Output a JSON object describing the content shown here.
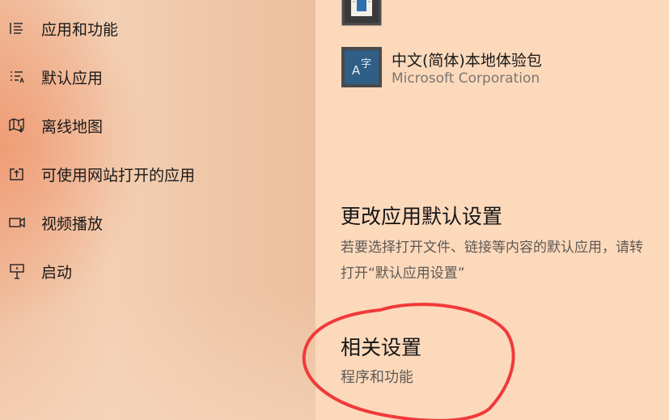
{
  "sidebar": {
    "items": [
      {
        "label": "应用和功能",
        "icon": "apps-features-icon"
      },
      {
        "label": "默认应用",
        "icon": "default-apps-icon"
      },
      {
        "label": "离线地图",
        "icon": "offline-maps-icon"
      },
      {
        "label": "可使用网站打开的应用",
        "icon": "apps-for-websites-icon"
      },
      {
        "label": "视频播放",
        "icon": "video-playback-icon"
      },
      {
        "label": "启动",
        "icon": "startup-icon"
      }
    ]
  },
  "main": {
    "apps": [
      {
        "name": "",
        "publisher": "",
        "icon": "app-icon",
        "partially_visible": true
      },
      {
        "name": "中文(简体)本地体验包",
        "publisher": "Microsoft Corporation",
        "icon": "language-pack-icon"
      }
    ],
    "change_defaults": {
      "title": "更改应用默认设置",
      "description_line1": "若要选择打开文件、链接等内容的默认应用，请转",
      "description_line2": "打开“默认应用设置”"
    },
    "related": {
      "title": "相关设置",
      "link": "程序和功能"
    }
  },
  "annotation": {
    "shape": "hand-drawn circle",
    "color": "#f03a3a"
  },
  "colors": {
    "sidebar_accent": "#f0966e",
    "main_bg": "#fdd9bc",
    "tile_bg": "#2f5e86",
    "tile_border": "#4a4a4a"
  }
}
